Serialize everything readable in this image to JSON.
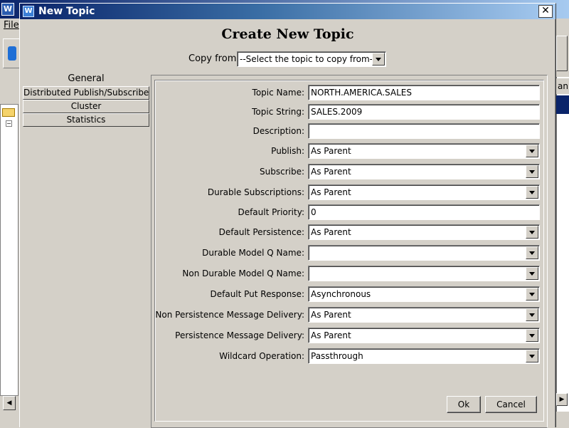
{
  "background_app": {
    "menu_file": "File",
    "right_header_text": "an"
  },
  "dialog": {
    "title": "New Topic",
    "close_glyph": "✕",
    "heading": "Create New Topic",
    "copy_from": {
      "label": "Copy from",
      "value": "--Select the topic to copy from--"
    },
    "nav": [
      {
        "label": "General",
        "selected": true
      },
      {
        "label": "Distributed Publish/Subscribe",
        "selected": false
      },
      {
        "label": "Cluster",
        "selected": false
      },
      {
        "label": "Statistics",
        "selected": false
      }
    ],
    "fields": [
      {
        "label": "Topic Name:",
        "type": "text",
        "value": "NORTH.AMERICA.SALES"
      },
      {
        "label": "Topic String:",
        "type": "text",
        "value": "SALES.2009"
      },
      {
        "label": "Description:",
        "type": "text",
        "value": ""
      },
      {
        "label": "Publish:",
        "type": "select",
        "value": "As Parent"
      },
      {
        "label": "Subscribe:",
        "type": "select",
        "value": "As Parent"
      },
      {
        "label": "Durable Subscriptions:",
        "type": "select",
        "value": "As Parent"
      },
      {
        "label": "Default Priority:",
        "type": "text",
        "value": "0"
      },
      {
        "label": "Default Persistence:",
        "type": "select",
        "value": "As Parent"
      },
      {
        "label": "Durable Model Q Name:",
        "type": "select",
        "value": ""
      },
      {
        "label": "Non Durable Model Q Name:",
        "type": "select",
        "value": ""
      },
      {
        "label": "Default Put Response:",
        "type": "select",
        "value": "Asynchronous"
      },
      {
        "label": "Non Persistence Message Delivery:",
        "type": "select",
        "value": "As Parent"
      },
      {
        "label": "Persistence Message Delivery:",
        "type": "select",
        "value": "As Parent"
      },
      {
        "label": "Wildcard Operation:",
        "type": "select",
        "value": "Passthrough"
      }
    ],
    "buttons": {
      "ok": "Ok",
      "cancel": "Cancel"
    }
  }
}
